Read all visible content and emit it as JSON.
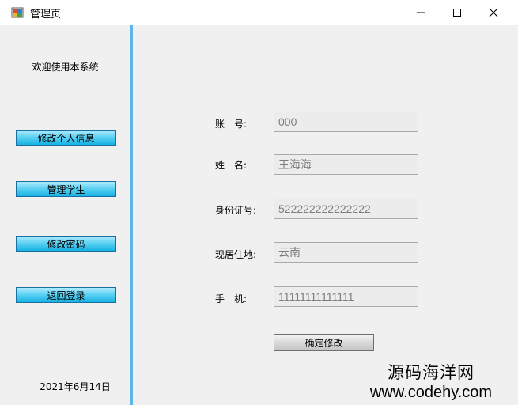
{
  "window": {
    "title": "管理页"
  },
  "sidebar": {
    "welcome": "欢迎使用本系统",
    "buttons": [
      "修改个人信息",
      "管理学生",
      "修改密码",
      "返回登录"
    ],
    "date": "2021年6月14日",
    "accent_color": "#5fb6e6",
    "button_color": "#3fc3ee"
  },
  "form": {
    "account_label": "账　号:",
    "account_value": "000",
    "name_label": "姓　名:",
    "name_value": "王海海",
    "id_label": "身份证号:",
    "id_value": "522222222222222",
    "address_label": "现居住地:",
    "address_value": "云南",
    "phone_label": "手　机:",
    "phone_value": "11111111111111",
    "confirm_label": "确定修改"
  },
  "watermark": {
    "line1": "源码海洋网",
    "line2": "www.codehy.com"
  }
}
